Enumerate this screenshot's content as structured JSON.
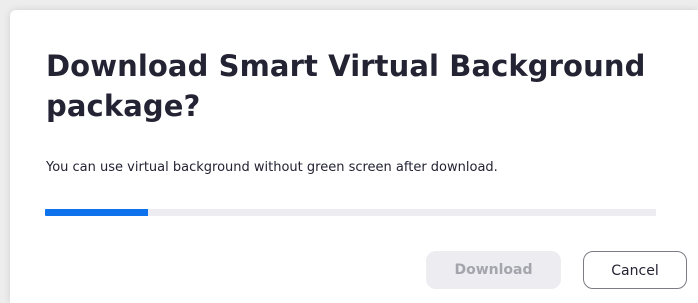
{
  "dialog": {
    "title": "Download Smart Virtual Background package?",
    "message": "You can use virtual background without green screen after download.",
    "progress_fraction": 0.168,
    "colors": {
      "progress_fill": "#0e72ed",
      "progress_track": "#ececf1",
      "title_text": "#232333"
    },
    "buttons": {
      "download_label": "Download",
      "download_state": "disabled",
      "cancel_label": "Cancel"
    }
  }
}
